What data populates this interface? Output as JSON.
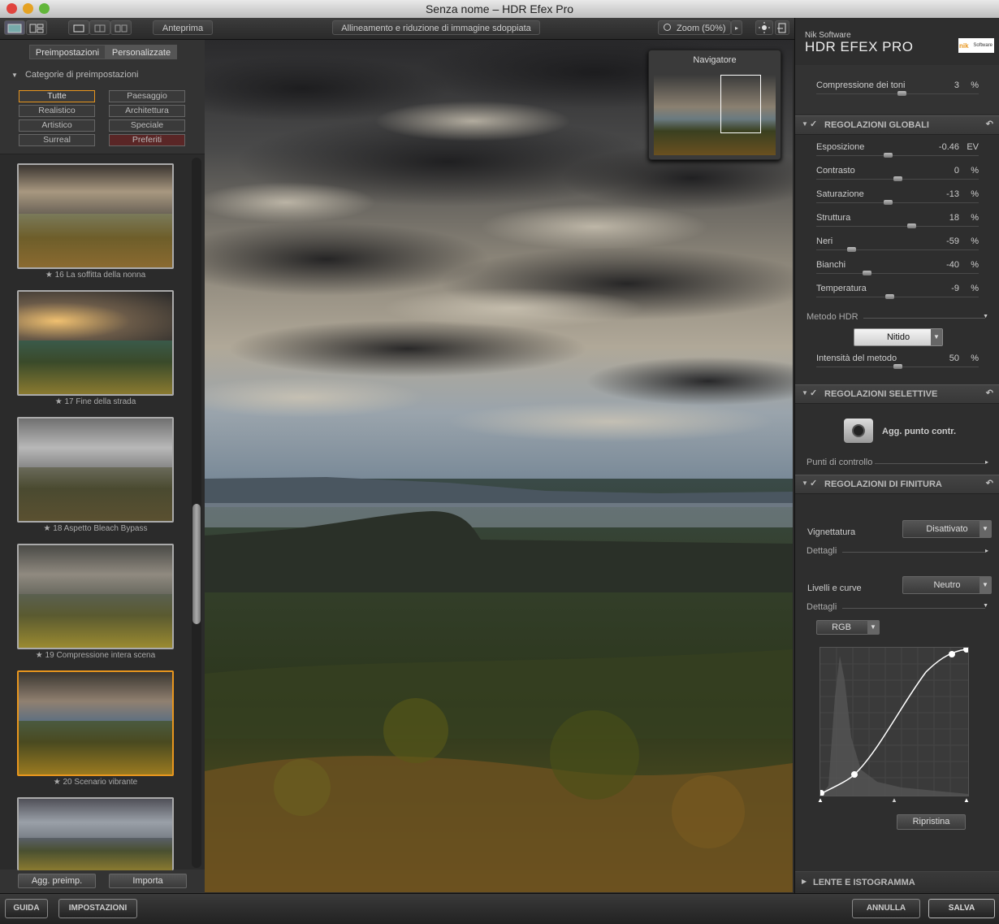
{
  "window": {
    "title": "Senza nome – HDR Efex Pro"
  },
  "toolbar": {
    "preview_label": "Anteprima",
    "align_label": "Allineamento e riduzione di immagine sdoppiata",
    "zoom_label": "Zoom (50%)"
  },
  "left": {
    "tabs": [
      "Preimpostazioni",
      "Personalizzate"
    ],
    "categories_title": "Categorie di preimpostazioni",
    "categories": [
      "Tutte",
      "Paesaggio",
      "Realistico",
      "Architettura",
      "Artistico",
      "Speciale",
      "Surreal",
      "Preferiti"
    ],
    "presets": [
      {
        "label": "16 La soffitta della nonna"
      },
      {
        "label": "17 Fine della strada"
      },
      {
        "label": "18 Aspetto Bleach Bypass"
      },
      {
        "label": "19 Compressione intera scena"
      },
      {
        "label": "20 Scenario vibrante"
      },
      {
        "label": ""
      }
    ],
    "selected_preset": 4,
    "add_preset_label": "Agg. preimp.",
    "import_label": "Importa"
  },
  "navigator": {
    "title": "Navigatore"
  },
  "right": {
    "brand_small": "Nik Software",
    "brand_big": "HDR EFEX PRO",
    "logo_text": "nik",
    "logo_sub": "Software",
    "tone_compression": {
      "label": "Compressione dei toni",
      "value": "3",
      "unit": "%",
      "level": 0.53
    },
    "global_title": "REGOLAZIONI GLOBALI",
    "global": [
      {
        "label": "Esposizione",
        "value": "-0.46",
        "unit": "EV",
        "level": 0.44
      },
      {
        "label": "Contrasto",
        "value": "0",
        "unit": "%",
        "level": 0.5
      },
      {
        "label": "Saturazione",
        "value": "-13",
        "unit": "%",
        "level": 0.44
      },
      {
        "label": "Struttura",
        "value": "18",
        "unit": "%",
        "level": 0.59
      },
      {
        "label": "Neri",
        "value": "-59",
        "unit": "%",
        "level": 0.2
      },
      {
        "label": "Bianchi",
        "value": "-40",
        "unit": "%",
        "level": 0.3
      },
      {
        "label": "Temperatura",
        "value": "-9",
        "unit": "%",
        "level": 0.45
      }
    ],
    "hdr_method_label": "Metodo HDR",
    "hdr_method_value": "Nitido",
    "method_intensity": {
      "label": "Intensità del metodo",
      "value": "50",
      "unit": "%",
      "level": 0.5
    },
    "selective_title": "REGOLAZIONI SELETTIVE",
    "add_control_point": "Agg. punto contr.",
    "control_points_label": "Punti di controllo",
    "finishing_title": "REGOLAZIONI DI FINITURA",
    "vignette_label": "Vignettatura",
    "vignette_value": "Disattivato",
    "details_label": "Dettagli",
    "levels_label": "Livelli e curve",
    "levels_value": "Neutro",
    "details_label2": "Dettagli",
    "channel_value": "RGB",
    "reset_label": "Ripristina",
    "lens_title": "LENTE E ISTOGRAMMA"
  },
  "bottom": {
    "help_label": "GUIDA",
    "settings_label": "IMPOSTAZIONI",
    "cancel_label": "ANNULLA",
    "save_label": "SALVA"
  },
  "colors": {
    "accent": "#e8961e",
    "favorites": "#6a2a2a"
  }
}
